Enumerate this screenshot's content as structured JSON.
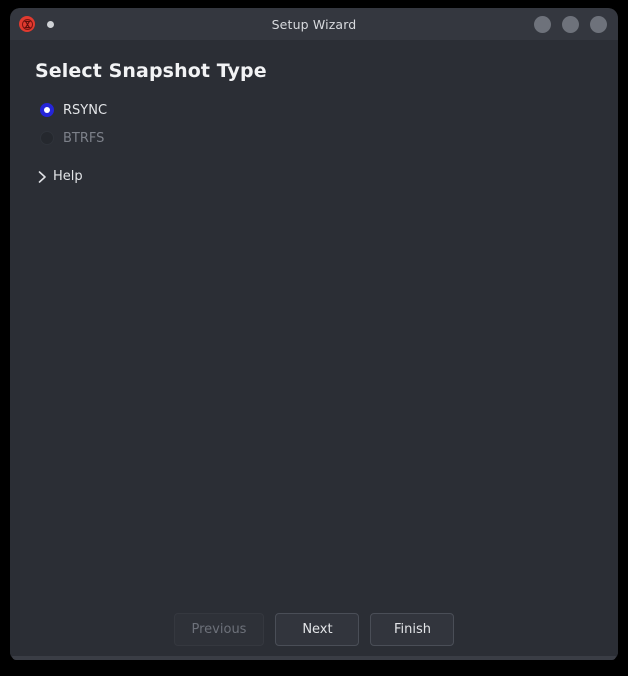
{
  "window": {
    "titlebar": {
      "app_icon": "app-logo-icon",
      "status_dot": "status-dot-icon",
      "title": "Setup Wizard",
      "controls": [
        {
          "name": "minimize-button",
          "icon": "minimize-icon"
        },
        {
          "name": "maximize-button",
          "icon": "maximize-icon"
        },
        {
          "name": "close-button",
          "icon": "close-icon"
        }
      ]
    }
  },
  "page": {
    "title": "Select Snapshot Type",
    "options": [
      {
        "label": "RSYNC",
        "selected": true,
        "disabled": false
      },
      {
        "label": "BTRFS",
        "selected": false,
        "disabled": true
      }
    ],
    "help": {
      "label": "Help",
      "icon": "chevron-right-icon",
      "expanded": false
    }
  },
  "footer": {
    "buttons": [
      {
        "label": "Previous",
        "disabled": true
      },
      {
        "label": "Next",
        "disabled": false
      },
      {
        "label": "Finish",
        "disabled": false
      }
    ]
  },
  "colors": {
    "window_background": "#2b2e35",
    "titlebar": "#34373f",
    "desktop": "#000000",
    "accent_radio": "#2525d8",
    "app_icon": "#e03a2f",
    "text_primary": "#e3e5e8",
    "text_muted": "#7d818a",
    "button_border": "#4a4e57"
  }
}
